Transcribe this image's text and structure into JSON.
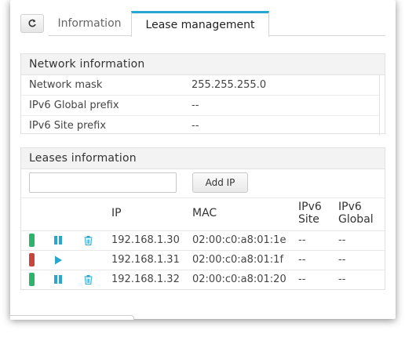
{
  "tabs": {
    "refresh_icon": "refresh-icon",
    "information": "Information",
    "lease_management": "Lease management",
    "accent": "#27a7cf"
  },
  "network": {
    "title": "Network information",
    "rows": [
      {
        "label": "Network mask",
        "value": "255.255.255.0"
      },
      {
        "label": "IPv6 Global prefix",
        "value": "--"
      },
      {
        "label": "IPv6 Site prefix",
        "value": "--"
      }
    ]
  },
  "leases": {
    "title": "Leases information",
    "input_value": "",
    "add_button": "Add IP",
    "headers": {
      "ip": "IP",
      "mac": "MAC",
      "ipv6_site_1": "IPv6",
      "ipv6_site_2": "Site",
      "ipv6_global_1": "IPv6",
      "ipv6_global_2": "Global"
    },
    "rows": [
      {
        "status": "active",
        "status_color": "#2db36b",
        "action": "pause-icon",
        "ip": "192.168.1.30",
        "mac": "02:00:c0:a8:01:1e",
        "ipv6_site": "--",
        "ipv6_global": "--"
      },
      {
        "status": "stopped",
        "status_color": "#c9453b",
        "action": "play-icon",
        "ip": "192.168.1.31",
        "mac": "02:00:c0:a8:01:1f",
        "ipv6_site": "--",
        "ipv6_global": "--"
      },
      {
        "status": "active",
        "status_color": "#2db36b",
        "action": "pause-icon",
        "ip": "192.168.1.32",
        "mac": "02:00:c0:a8:01:20",
        "ipv6_site": "--",
        "ipv6_global": "--"
      }
    ]
  }
}
